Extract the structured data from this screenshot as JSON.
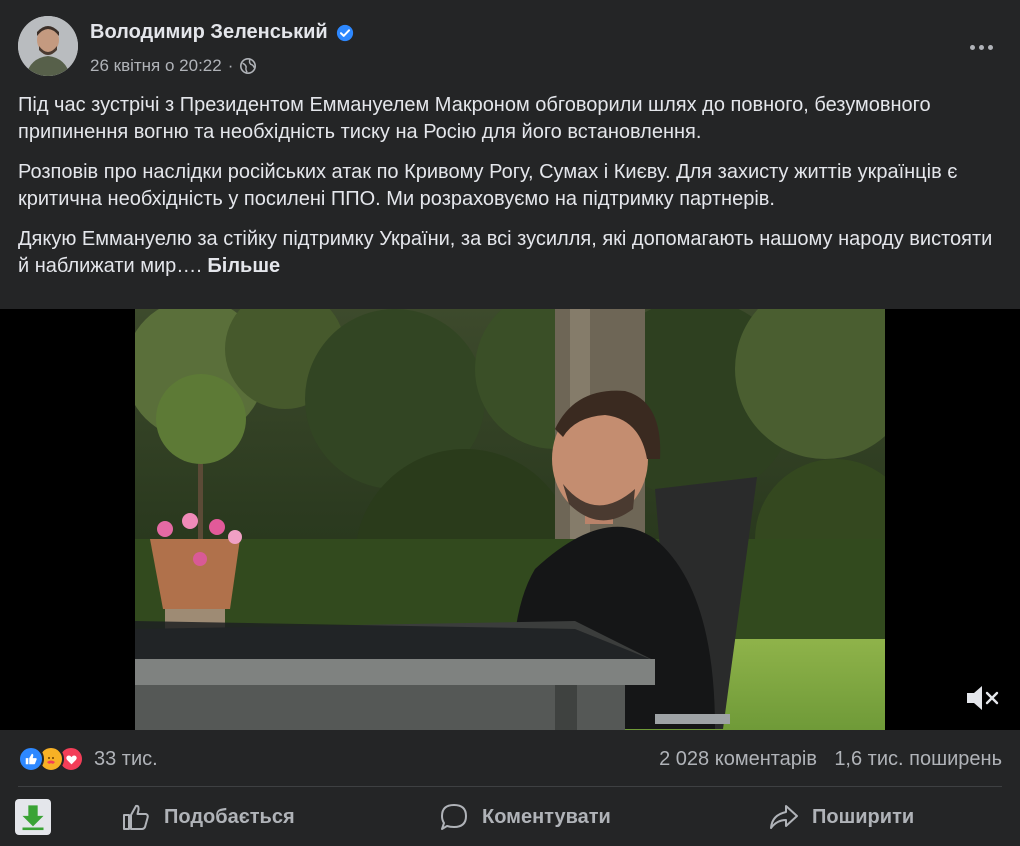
{
  "post": {
    "author": "Володимир Зеленський",
    "timestamp": "26 квітня о 20:22",
    "paragraphs": [
      "Під час зустрічі з Президентом Еммануелем Макроном обговорили шлях до повного, безумовного припинення вогню та необхідність тиску на Росію для його встановлення.",
      "Розповів про наслідки російських атак по Кривому Рогу, Сумах і Києву. Для захисту життів українців є критична необхідність у посилені ППО. Ми розраховуємо на підтримку партнерів.",
      "Дякую Еммануелю за стійку підтримку України, за всі зусилля, які допомагають нашому народу вистояти й наближати мир…."
    ],
    "see_more": "Більше"
  },
  "stats": {
    "reactions_count": "33 тис.",
    "comments": "2 028 коментарів",
    "shares": "1,6 тис. поширень"
  },
  "actions": {
    "like": "Подобається",
    "comment": "Коментувати",
    "share": "Поширити"
  },
  "icons": {
    "verified": "verified-badge-icon",
    "privacy": "globe-icon",
    "menu": "more-options-icon",
    "mute": "muted-speaker-icon",
    "download": "download-arrow-icon",
    "like": "thumbs-up-icon",
    "comment": "comment-bubble-icon",
    "share": "share-arrow-icon"
  },
  "colors": {
    "background": "#242526",
    "text": "#e4e6eb",
    "muted": "#b0b3b8",
    "verified": "#2d88ff",
    "like_reaction": "#2d88ff",
    "love_reaction": "#f33e58",
    "care_reaction": "#f7b125",
    "download": "#3aa335"
  }
}
